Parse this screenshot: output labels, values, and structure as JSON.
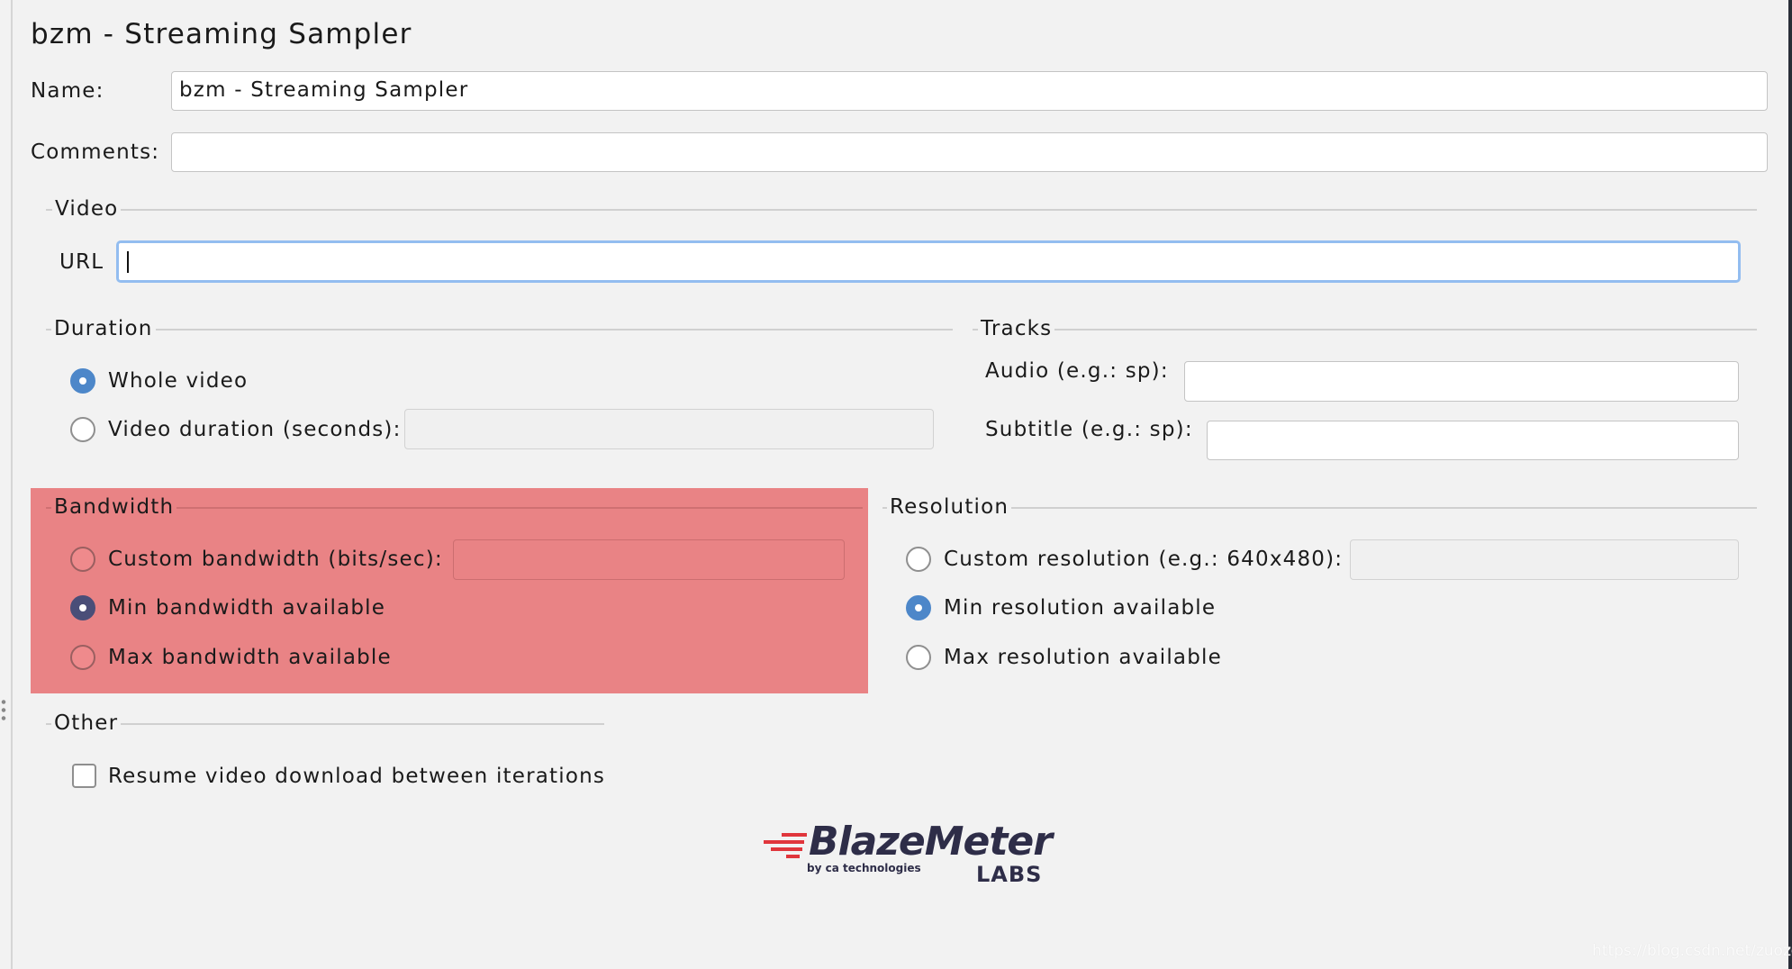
{
  "title": "bzm - Streaming Sampler",
  "name": {
    "label": "Name:",
    "value": "bzm - Streaming Sampler"
  },
  "comments": {
    "label": "Comments:",
    "value": ""
  },
  "video": {
    "legend": "Video",
    "url_label": "URL",
    "url_value": ""
  },
  "duration": {
    "legend": "Duration",
    "whole_video": "Whole video",
    "video_duration": "Video duration (seconds):",
    "selected": "whole_video"
  },
  "tracks": {
    "legend": "Tracks",
    "audio_label": "Audio (e.g.: sp):",
    "subtitle_label": "Subtitle (e.g.: sp):"
  },
  "bandwidth": {
    "legend": "Bandwidth",
    "custom": "Custom bandwidth (bits/sec):",
    "min": "Min bandwidth available",
    "max": "Max bandwidth available",
    "selected": "min",
    "highlight_color": "#e98385"
  },
  "resolution": {
    "legend": "Resolution",
    "custom": "Custom resolution (e.g.: 640x480):",
    "min": "Min resolution available",
    "max": "Max resolution available",
    "selected": "min"
  },
  "other": {
    "legend": "Other",
    "resume": "Resume video download between iterations",
    "resume_checked": false
  },
  "logo": {
    "brand": "BlazeMeter",
    "byline": "by ca technologies",
    "labs": "LABS"
  },
  "watermark": "https://blog.csdn.net/zuozewei",
  "colors": {
    "accent": "#4d87c9",
    "focus": "#93bdf0",
    "logo_red": "#e0363c",
    "logo_navy": "#2e2d48"
  }
}
